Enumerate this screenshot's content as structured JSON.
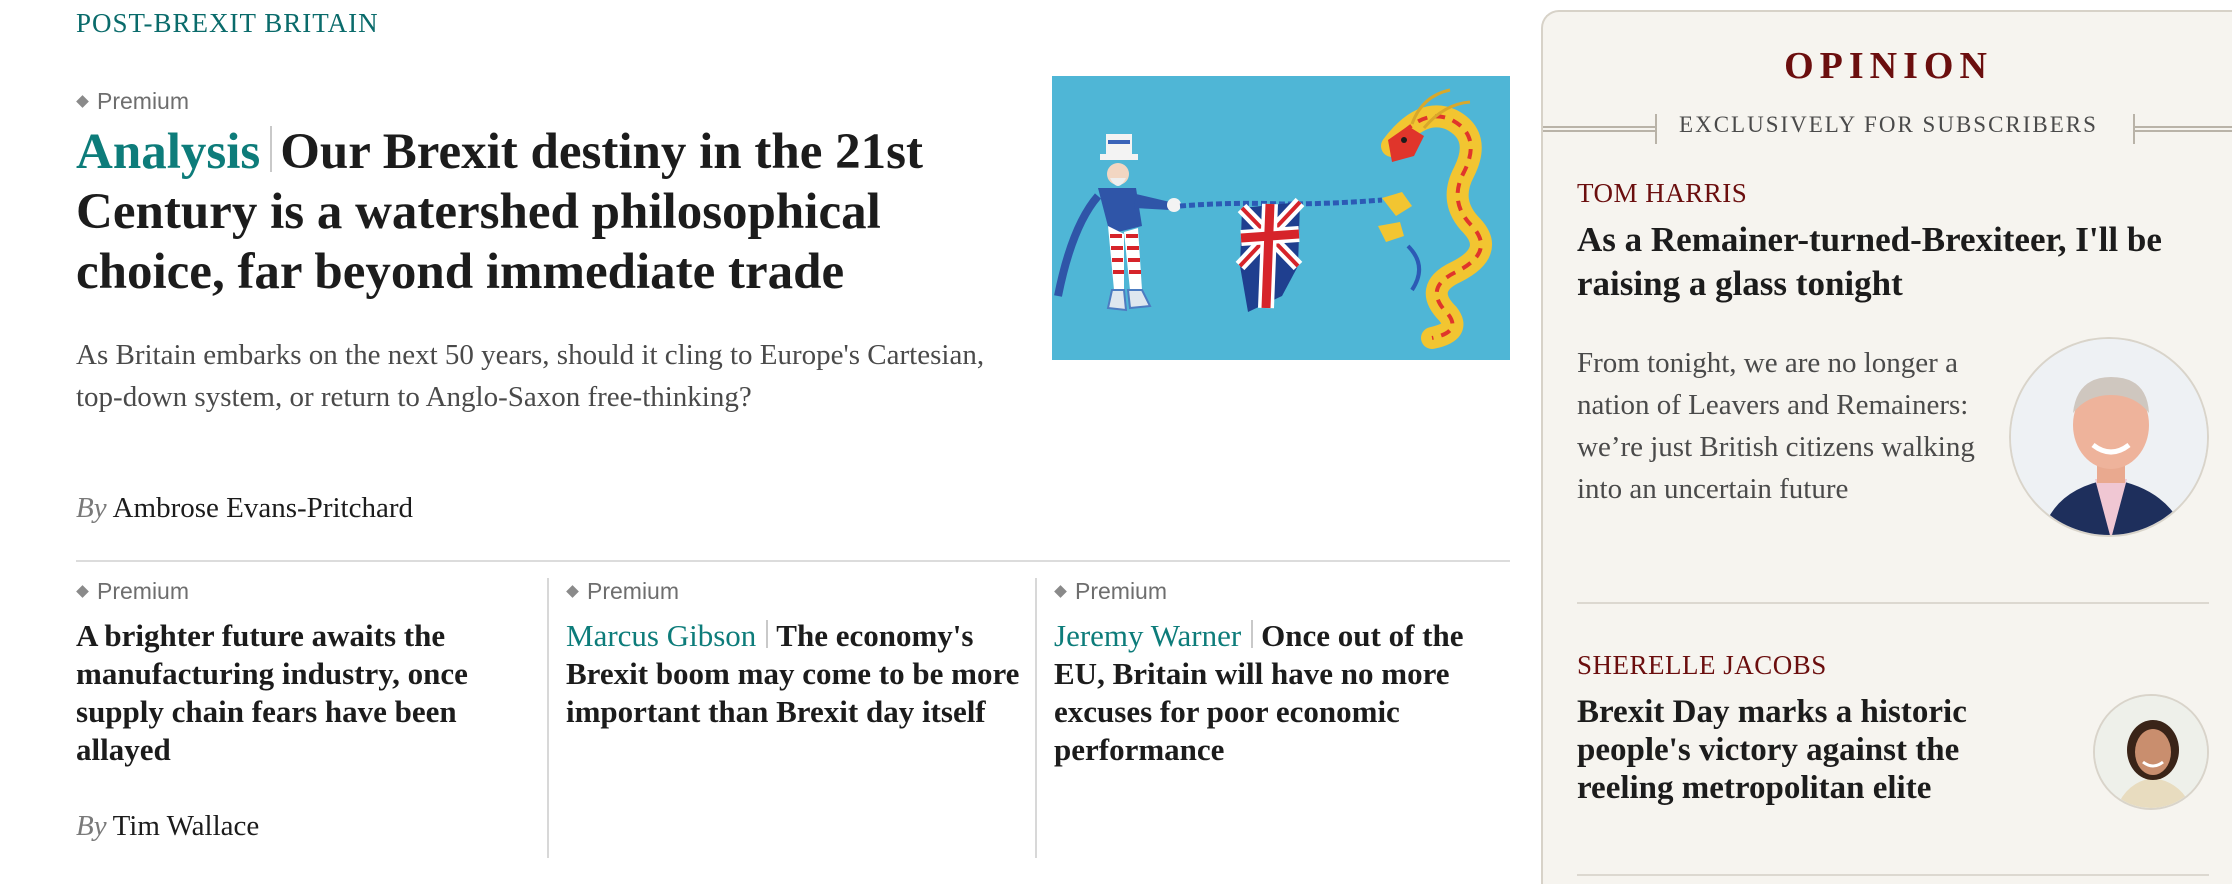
{
  "section": {
    "label": "POST-BREXIT BRITAIN"
  },
  "lead": {
    "premium": "Premium",
    "kicker": "Analysis",
    "headline": "Our Brexit destiny in the 21st Century is a watershed philosophical choice, far beyond immediate trade",
    "standfirst": "As Britain embarks on the next 50 years, should it cling to Europe's Cartesian, top-down system, or return to Anglo-Saxon free-thinking?",
    "by": "By",
    "author": "Ambrose Evans-Pritchard",
    "image_icon": "tug-of-war-illustration"
  },
  "subs": [
    {
      "premium": "Premium",
      "headline": "A brighter future awaits the manufacturing industry, once supply chain fears have been allayed",
      "by": "By",
      "author": "Tim Wallace"
    },
    {
      "premium": "Premium",
      "kicker": "Marcus Gibson",
      "headline": "The economy's Brexit boom may come to be more important than Brexit day itself"
    },
    {
      "premium": "Premium",
      "kicker": "Jeremy Warner",
      "headline": "Once out of the EU, Britain will have no more excuses for poor economic performance"
    }
  ],
  "opinion": {
    "title": "OPINION",
    "subtitle": "EXCLUSIVELY FOR SUBSCRIBERS",
    "items": [
      {
        "author": "TOM HARRIS",
        "headline": "As a Remainer-turned-Brexiteer, I'll be raising a glass tonight",
        "standfirst": "From tonight, we are no longer a nation of Leavers and Remainers: we’re just British citizens walking into an uncertain future",
        "avatar_icon": "author-portrait"
      },
      {
        "author": "SHERELLE JACOBS",
        "headline": "Brexit Day marks a historic people's victory against the reeling metropolitan elite",
        "avatar_icon": "author-portrait"
      }
    ]
  },
  "colors": {
    "teal": "#0d7c7a",
    "maroon": "#6b0e0e",
    "panel": "#f6f4ef",
    "image_bg": "#4fb6d6"
  }
}
